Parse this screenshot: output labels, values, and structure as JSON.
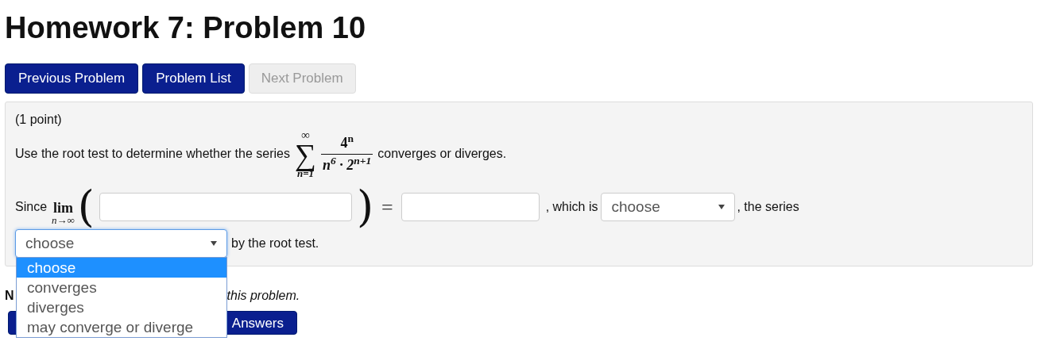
{
  "title": "Homework 7: Problem 10",
  "nav_buttons": [
    {
      "label": "Previous Problem",
      "disabled": false
    },
    {
      "label": "Problem List",
      "disabled": false
    },
    {
      "label": "Next Problem",
      "disabled": true
    }
  ],
  "problem": {
    "points": "(1 point)",
    "intro": "Use the root test to determine whether the series",
    "sum": {
      "upper": "∞",
      "symbol": "∑",
      "lower": "n=1",
      "numerator": "4$^{n}$",
      "denominator": "n$^{6}$ · 2$^{n+1}$"
    },
    "outro": "converges or diverges.",
    "since": "Since",
    "lim": "lim",
    "lim_sub": "n→∞",
    "open_paren": "(",
    "close_paren": ")",
    "equals": "=",
    "which_is": ", which is",
    "select_1": {
      "value": "choose",
      "expanded": false
    },
    "the_series": ", the series",
    "select_2": {
      "value": "choose",
      "expanded": true,
      "options": [
        {
          "label": "choose",
          "selected": true
        },
        {
          "label": "converges",
          "selected": false
        },
        {
          "label": "diverges",
          "selected": false
        },
        {
          "label": "may converge or diverge",
          "selected": false
        }
      ]
    },
    "by_root": "by the root test."
  },
  "note": {
    "lead": "N",
    "tail": "this problem."
  },
  "submit_button": {
    "label": "Answers"
  }
}
